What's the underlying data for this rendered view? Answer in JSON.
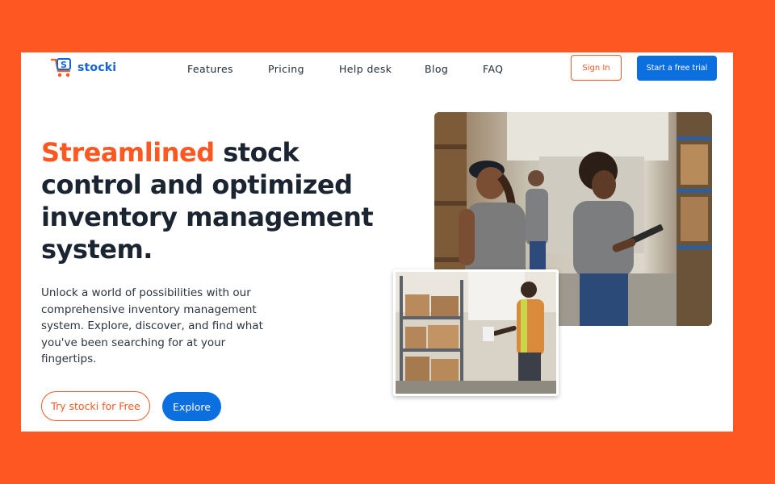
{
  "brand": {
    "name": "stocki",
    "logo_icon": "cart-s-icon",
    "primary_color": "#0b6fdf",
    "accent_color": "#ff5722"
  },
  "nav": {
    "items": [
      "Features",
      "Pricing",
      "Help desk",
      "Blog",
      "FAQ"
    ]
  },
  "header": {
    "signin_label": "Sign In",
    "trial_label": "Start a free trial"
  },
  "hero": {
    "headline_accent": "Streamlined",
    "headline_rest": " stock control and optimized inventory management system.",
    "subtext": "Unlock a world of possibilities with our comprehensive inventory management system. Explore, discover, and find what you've been searching for at your fingertips.",
    "cta_primary": "Try stocki for Free",
    "cta_secondary": "Explore"
  }
}
